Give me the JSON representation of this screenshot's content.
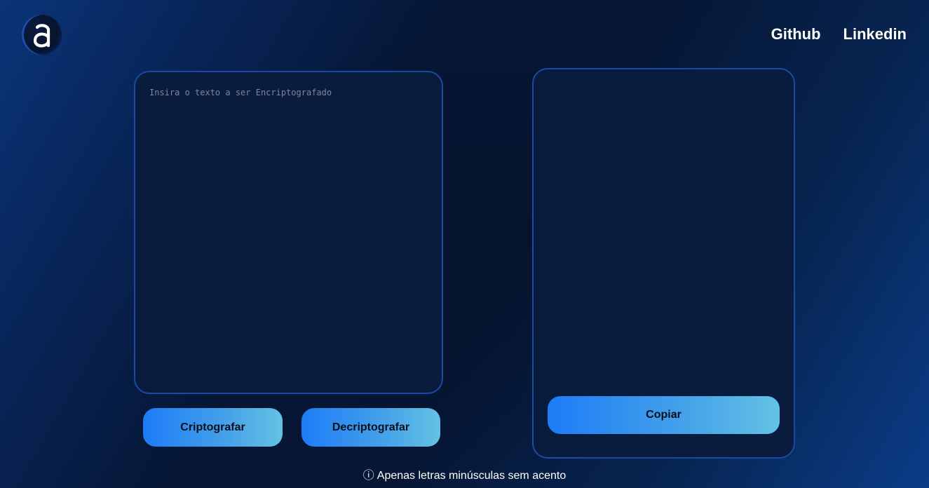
{
  "logo": {
    "letter": "a",
    "icon": "logo-a-icon"
  },
  "nav": {
    "links": [
      {
        "label": "Github"
      },
      {
        "label": "Linkedin"
      }
    ]
  },
  "input": {
    "placeholder": "Insira o texto a ser Encriptografado",
    "value": ""
  },
  "actions": {
    "encrypt_label": "Criptografar",
    "decrypt_label": "Decriptografar"
  },
  "output": {
    "text": "",
    "copy_label": "Copiar"
  },
  "footer": {
    "info_icon": "ⓘ",
    "note": "Apenas letras minúsculas sem acento"
  },
  "colors": {
    "accent_start": "#1d7cf7",
    "accent_end": "#63c2e4",
    "panel_bg": "#0a1c3e",
    "panel_border": "#1a4aa3"
  }
}
